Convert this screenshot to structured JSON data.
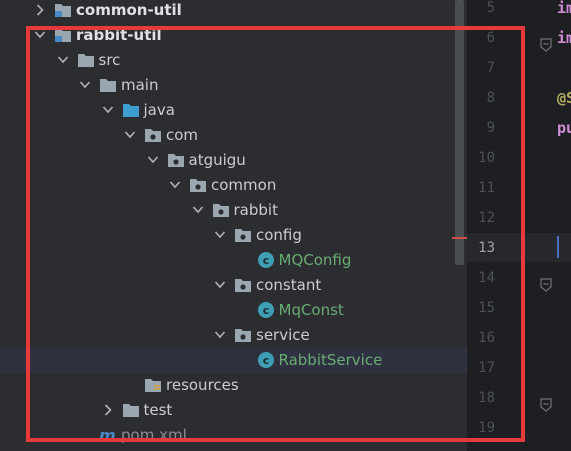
{
  "colors": {
    "highlight": "#e8393b",
    "green_class": "#6aab73",
    "bg": "#2b2d30"
  },
  "tree": [
    {
      "label": "common-util",
      "icon": "module-folder-icon",
      "arrow": "right",
      "bold": true
    },
    {
      "label": "rabbit-util",
      "icon": "module-folder-icon",
      "arrow": "down",
      "bold": true
    },
    {
      "label": "src",
      "icon": "folder-icon",
      "arrow": "down"
    },
    {
      "label": "main",
      "icon": "folder-icon",
      "arrow": "down"
    },
    {
      "label": "java",
      "icon": "source-folder-icon",
      "arrow": "down"
    },
    {
      "label": "com",
      "icon": "package-icon",
      "arrow": "down"
    },
    {
      "label": "atguigu",
      "icon": "package-icon",
      "arrow": "down"
    },
    {
      "label": "common",
      "icon": "package-icon",
      "arrow": "down"
    },
    {
      "label": "rabbit",
      "icon": "package-icon",
      "arrow": "down"
    },
    {
      "label": "config",
      "icon": "package-icon",
      "arrow": "down"
    },
    {
      "label": "MQConfig",
      "icon": "java-class-icon",
      "arrow": "none",
      "green": true
    },
    {
      "label": "constant",
      "icon": "package-icon",
      "arrow": "down"
    },
    {
      "label": "MqConst",
      "icon": "java-class-icon",
      "arrow": "none",
      "green": true
    },
    {
      "label": "service",
      "icon": "package-icon",
      "arrow": "down"
    },
    {
      "label": "RabbitService",
      "icon": "java-class-icon",
      "arrow": "none",
      "green": true,
      "selected": true
    },
    {
      "label": "resources",
      "icon": "resources-folder-icon",
      "arrow": "none"
    },
    {
      "label": "test",
      "icon": "folder-icon",
      "arrow": "right"
    },
    {
      "label": "pom.xml",
      "icon": "maven-icon",
      "arrow": "none",
      "pom": true
    }
  ],
  "editor": {
    "line_numbers": [
      "5",
      "6",
      "7",
      "8",
      "9",
      "10",
      "11",
      "12",
      "13",
      "14",
      "15",
      "16",
      "17",
      "18",
      "19"
    ],
    "current_line": "13",
    "fragments": [
      {
        "line": "5",
        "text": "im",
        "color": "#cf8ed6"
      },
      {
        "line": "6",
        "text": "im",
        "color": "#cf8ed6"
      },
      {
        "line": "8",
        "text": "@S",
        "color": "#b3ae60"
      },
      {
        "line": "9",
        "text": "pu",
        "color": "#cf8ed6"
      }
    ]
  }
}
